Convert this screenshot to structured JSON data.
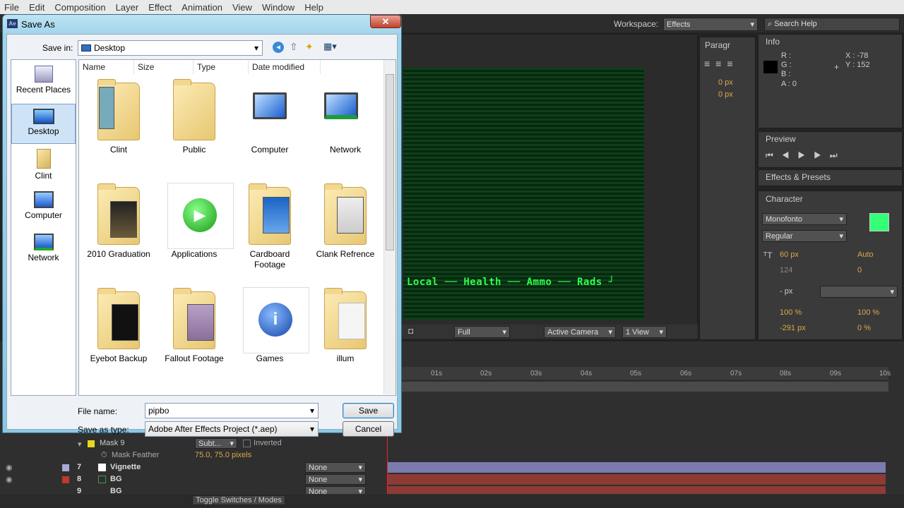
{
  "menu": [
    "File",
    "Edit",
    "Composition",
    "Layer",
    "Effect",
    "Animation",
    "View",
    "Window",
    "Help"
  ],
  "workspace": {
    "label": "Workspace:",
    "value": "Effects",
    "search": "Search Help"
  },
  "paragraph_tab": "Paragr",
  "paragraph_values": [
    "0 px",
    "0 px"
  ],
  "info": {
    "tab": "Info",
    "r": "R :",
    "g": "G :",
    "b": "B :",
    "a": "A : 0",
    "x": "X : -78",
    "y": "Y : 152"
  },
  "preview_tab": "Preview",
  "effects_tab": "Effects & Presets",
  "character": {
    "tab": "Character",
    "font": "Monofonto",
    "style": "Regular",
    "size": "60 px",
    "leading": "Auto",
    "kerning": "124",
    "tracking": "0",
    "stroke": "- px",
    "vscale": "100 %",
    "hscale": "100 %",
    "baseline": "-291 px",
    "tsume": "0 %",
    "color": "#33ff77"
  },
  "comp": {
    "hud": [
      "Local",
      "Health",
      "Ammo",
      "Rads"
    ],
    "resolution": "Full",
    "camera": "Active Camera",
    "views": "1 View"
  },
  "timeline": {
    "ticks": [
      "01s",
      "02s",
      "03s",
      "04s",
      "05s",
      "06s",
      "07s",
      "08s",
      "09s",
      "10s"
    ],
    "mask": "Mask 9",
    "mask_mode": "Subt...",
    "inverted": "Inverted",
    "feather_label": "Mask Feather",
    "feather": "75.0, 75.0 pixels",
    "layers": [
      {
        "num": "7",
        "name": "Vignette",
        "parent": "None"
      },
      {
        "num": "8",
        "name": "BG",
        "parent": "None"
      },
      {
        "num": "9",
        "name": "BG",
        "parent": "None"
      }
    ],
    "toggle": "Toggle Switches / Modes"
  },
  "dialog": {
    "title": "Save As",
    "close": "✕",
    "save_in_label": "Save in:",
    "save_in": "Desktop",
    "columns": [
      "Name",
      "Size",
      "Type",
      "Date modified"
    ],
    "places": [
      "Recent Places",
      "Desktop",
      "Clint",
      "Computer",
      "Network"
    ],
    "items": [
      "Clint",
      "Public",
      "Computer",
      "Network",
      "2010 Graduation",
      "Applications",
      "Cardboard Footage",
      "Clank Refrence",
      "Eyebot Backup",
      "Fallout Footage",
      "Games",
      "illum"
    ],
    "filename_label": "File name:",
    "filename": "pipbo",
    "type_label": "Save as type:",
    "type": "Adobe After Effects Project (*.aep)",
    "save": "Save",
    "cancel": "Cancel"
  }
}
